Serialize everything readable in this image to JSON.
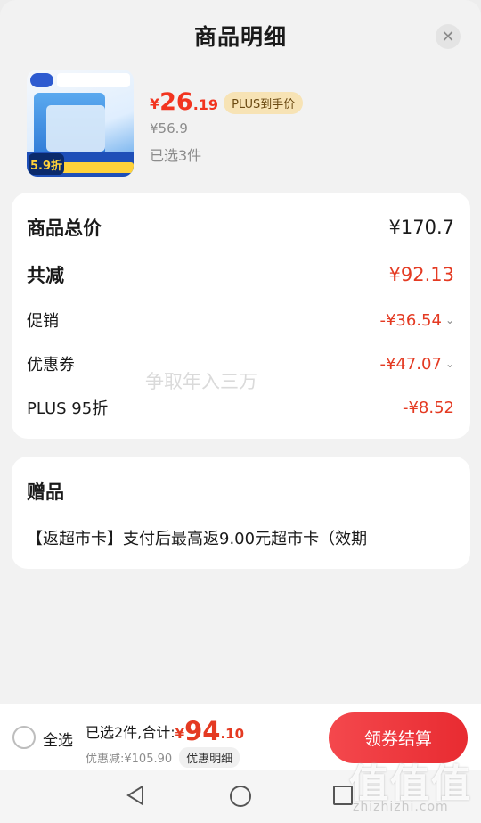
{
  "header": {
    "title": "商品明细"
  },
  "product": {
    "thumb_promo": "5.9折",
    "price_yen": "¥",
    "price_int": "26",
    "price_dec": ".19",
    "plus_badge": "PLUS到手价",
    "orig_price": "¥56.9",
    "selected_count": "已选3件"
  },
  "summary": {
    "rows": [
      {
        "label": "商品总价",
        "value": "¥170.7"
      },
      {
        "label": "共减",
        "value": "¥92.13"
      },
      {
        "label": "促销",
        "value": "-¥36.54"
      },
      {
        "label": "优惠券",
        "value": "-¥47.07"
      },
      {
        "label": "PLUS 95折",
        "value": "-¥8.52"
      }
    ],
    "watermark": "争取年入三万"
  },
  "gift": {
    "title": "赠品",
    "text": "【返超市卡】支付后最高返9.00元超市卡（效期"
  },
  "bottom": {
    "select_all": "全选",
    "sum_label": "已选2件,合计:",
    "sum_yen": "¥",
    "sum_int": "94",
    "sum_dec": ".10",
    "discount_text": "优惠减:¥105.90",
    "detail_chip": "优惠明细",
    "checkout": "领券结算"
  },
  "overlay": {
    "brand": "值值值",
    "site": "zhizhizhi.com"
  },
  "colors": {
    "accent_red": "#e43a22",
    "plus_gold": "#f7e3b5",
    "button_red": "#e82b31"
  }
}
